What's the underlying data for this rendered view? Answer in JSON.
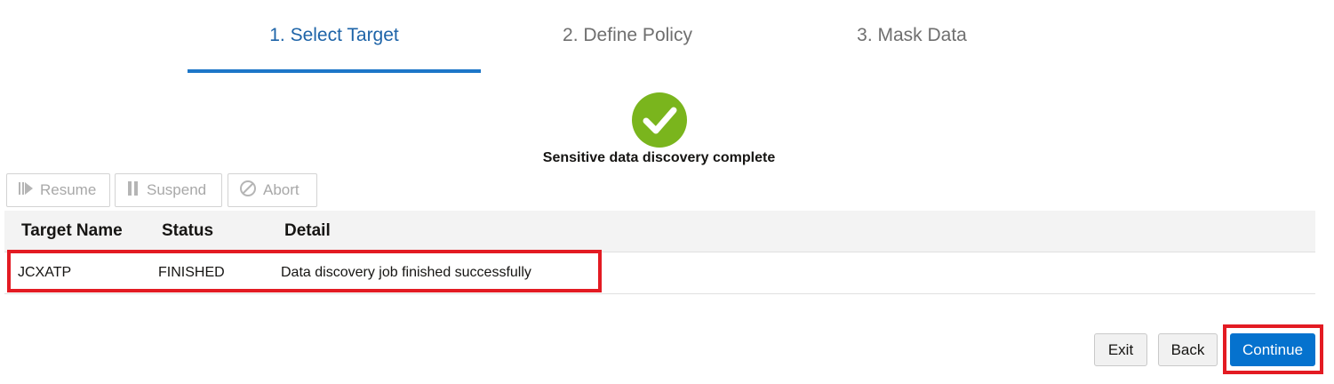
{
  "steps": [
    {
      "label": "1. Select Target",
      "active": true
    },
    {
      "label": "2. Define Policy",
      "active": false
    },
    {
      "label": "3. Mask Data",
      "active": false
    }
  ],
  "status": {
    "icon": "check-circle-icon",
    "message": "Sensitive data discovery complete",
    "color": "#7ab51d"
  },
  "toolbar": {
    "resume_label": "Resume",
    "suspend_label": "Suspend",
    "abort_label": "Abort"
  },
  "table": {
    "columns": [
      "Target Name",
      "Status",
      "Detail"
    ],
    "rows": [
      {
        "target_name": "JCXATP",
        "status": "FINISHED",
        "detail": "Data discovery job finished successfully"
      }
    ]
  },
  "actions": {
    "exit_label": "Exit",
    "back_label": "Back",
    "continue_label": "Continue"
  },
  "colors": {
    "accent": "#1c76c8",
    "primary_button": "#0572ce",
    "highlight": "#e31b23"
  }
}
